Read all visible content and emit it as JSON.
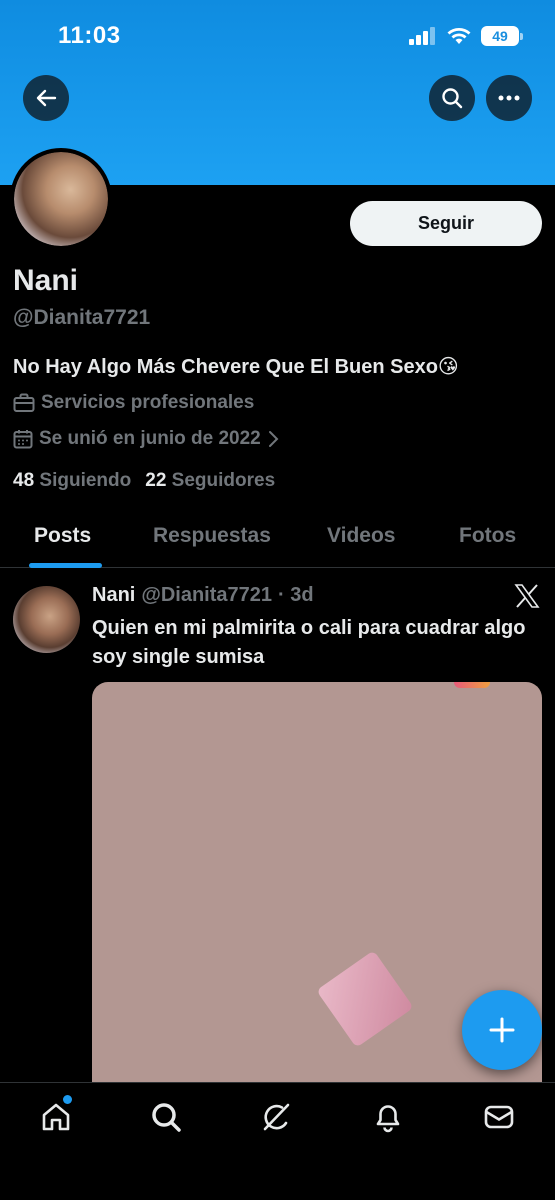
{
  "status_bar": {
    "time": "11:03",
    "battery": "49"
  },
  "header": {
    "back_icon": "back-arrow-icon",
    "search_icon": "search-icon",
    "more_icon": "more-icon"
  },
  "profile": {
    "display_name": "Nani",
    "handle": "@Dianita7721",
    "bio": "No Hay Algo Más Chevere Que El Buen Sexo😘",
    "category": "Servicios profesionales",
    "joined": "Se unió en junio de 2022",
    "following_count": "48",
    "following_label": "Siguiendo",
    "followers_count": "22",
    "followers_label": "Seguidores",
    "follow_button": "Seguir"
  },
  "tabs": [
    {
      "label": "Posts",
      "active": true
    },
    {
      "label": "Respuestas",
      "active": false
    },
    {
      "label": "Videos",
      "active": false
    },
    {
      "label": "Fotos",
      "active": false
    }
  ],
  "post": {
    "name": "Nani",
    "handle": "@Dianita7721",
    "time": "· 3d",
    "text": "Quien en mi palmirita o cali para cuadrar algo soy single sumisa"
  },
  "colors": {
    "accent": "#1d9bf0",
    "banner": "#1da1f2",
    "background": "#000000",
    "muted": "#71767b"
  },
  "bottom_nav": [
    "home-icon",
    "search-icon",
    "grok-icon",
    "notifications-icon",
    "messages-icon"
  ]
}
